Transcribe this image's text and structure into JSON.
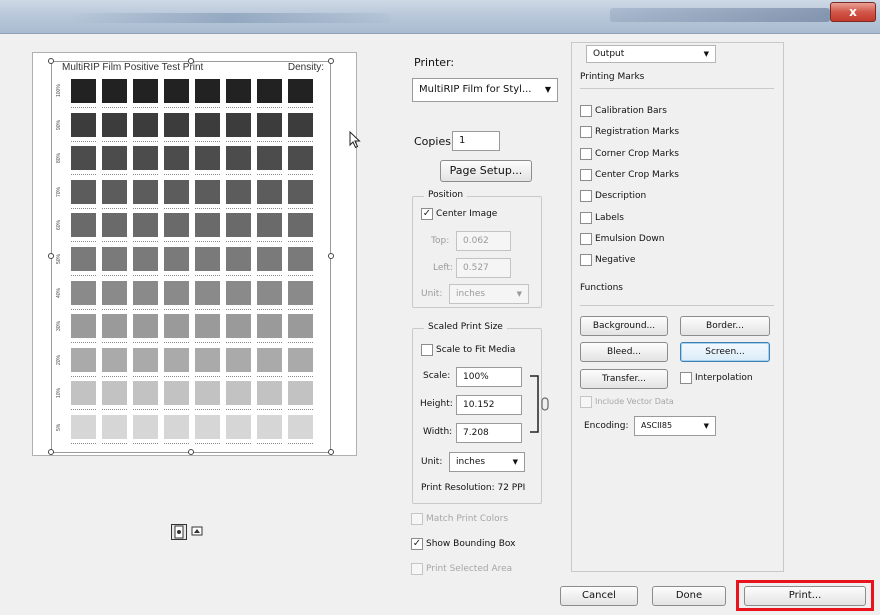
{
  "window": {
    "close_label": "x"
  },
  "preview": {
    "page_title": "MultiRIP Film Positive Test Print",
    "density_label": "Density:",
    "row_labels": [
      "100%",
      "90%",
      "80%",
      "70%",
      "60%",
      "50%",
      "40%",
      "30%",
      "20%",
      "10%",
      "5%"
    ],
    "row_colors": [
      "#222222",
      "#3c3c3c",
      "#4c4c4c",
      "#5c5c5c",
      "#6a6a6a",
      "#7a7a7a",
      "#8a8a8a",
      "#9a9a9a",
      "#aaaaaa",
      "#c2c2c2",
      "#d6d6d6"
    ]
  },
  "printer": {
    "label": "Printer:",
    "value": "MultiRIP Film for Styl..."
  },
  "copies": {
    "label": "Copies:",
    "value": "1"
  },
  "page_setup_label": "Page Setup...",
  "position": {
    "legend": "Position",
    "center_image_label": "Center Image",
    "center_image_checked": true,
    "top_label": "Top:",
    "top_value": "0.062",
    "left_label": "Left:",
    "left_value": "0.527",
    "unit_label": "Unit:",
    "unit_value": "inches"
  },
  "scaled": {
    "legend": "Scaled Print Size",
    "scale_to_fit_label": "Scale to Fit Media",
    "scale_to_fit_checked": false,
    "scale_label": "Scale:",
    "scale_value": "100%",
    "height_label": "Height:",
    "height_value": "10.152",
    "width_label": "Width:",
    "width_value": "7.208",
    "unit_label": "Unit:",
    "unit_value": "inches",
    "resolution_text": "Print Resolution: 72 PPI"
  },
  "bottom_options": {
    "match_print_colors": "Match Print Colors",
    "show_bounding_box": "Show Bounding Box",
    "show_bounding_box_checked": true,
    "print_selected_area": "Print Selected Area"
  },
  "output": {
    "dropdown_value": "Output",
    "printing_marks_title": "Printing Marks",
    "marks": [
      "Calibration Bars",
      "Registration Marks",
      "Corner Crop Marks",
      "Center Crop Marks",
      "Description",
      "Labels",
      "Emulsion Down",
      "Negative"
    ],
    "functions_title": "Functions",
    "background_btn": "Background...",
    "border_btn": "Border...",
    "bleed_btn": "Bleed...",
    "screen_btn": "Screen...",
    "transfer_btn": "Transfer...",
    "interpolation_label": "Interpolation",
    "include_vector_label": "Include Vector Data",
    "encoding_label": "Encoding:",
    "encoding_value": "ASCII85"
  },
  "footer": {
    "cancel": "Cancel",
    "done": "Done",
    "print": "Print..."
  },
  "colors": {
    "highlight": "#e8131c",
    "focus_border": "#3c7fb1"
  }
}
